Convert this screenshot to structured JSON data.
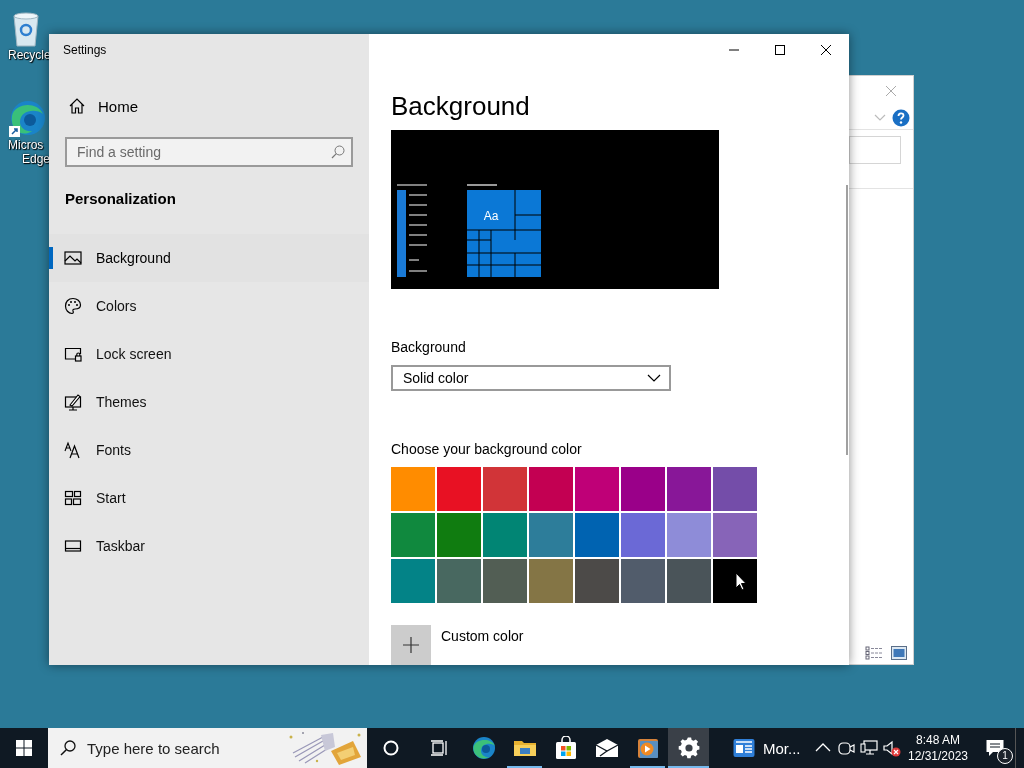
{
  "desktop_icons": [
    {
      "kind": "recycle",
      "lines": [
        "Recycle"
      ]
    },
    {
      "kind": "edge",
      "lines": [
        "Micros",
        "Edge"
      ]
    }
  ],
  "window": {
    "title": "Settings"
  },
  "sidebar": {
    "home": "Home",
    "search": {
      "placeholder": "Find a setting"
    },
    "section": "Personalization",
    "items": [
      {
        "kind": "background",
        "label": "Background",
        "selected": true
      },
      {
        "kind": "colors",
        "label": "Colors",
        "selected": false
      },
      {
        "kind": "lock",
        "label": "Lock screen",
        "selected": false
      },
      {
        "kind": "themes",
        "label": "Themes",
        "selected": false
      },
      {
        "kind": "fonts",
        "label": "Fonts",
        "selected": false
      },
      {
        "kind": "start",
        "label": "Start",
        "selected": false
      },
      {
        "kind": "taskbar",
        "label": "Taskbar",
        "selected": false
      }
    ]
  },
  "content": {
    "title": "Background",
    "preview": {
      "tile_label": "Aa"
    },
    "background_field": {
      "label": "Background",
      "value": "Solid color"
    },
    "color_heading": "Choose your background color",
    "colors": [
      {
        "color": "#ff8c00"
      },
      {
        "color": "#e81123"
      },
      {
        "color": "#d13438"
      },
      {
        "color": "#c30052"
      },
      {
        "color": "#bf0077"
      },
      {
        "color": "#9a0089"
      },
      {
        "color": "#881798"
      },
      {
        "color": "#744da9"
      },
      {
        "color": "#10893e"
      },
      {
        "color": "#107c10"
      },
      {
        "color": "#018574"
      },
      {
        "color": "#2d7d9a"
      },
      {
        "color": "#0063b1"
      },
      {
        "color": "#6b69d6"
      },
      {
        "color": "#8e8cd8"
      },
      {
        "color": "#8764b8"
      },
      {
        "color": "#038387"
      },
      {
        "color": "#486860"
      },
      {
        "color": "#525e54"
      },
      {
        "color": "#847545"
      },
      {
        "color": "#4c4a48"
      },
      {
        "color": "#515c6b"
      },
      {
        "color": "#4a5459"
      },
      {
        "color": "#000000"
      }
    ],
    "custom_color": "Custom color"
  },
  "taskbar": {
    "search": {
      "placeholder": "Type here to search"
    },
    "apps": [
      {
        "kind": "edge",
        "running": false,
        "active": false
      },
      {
        "kind": "explorer",
        "running": true,
        "active": false
      },
      {
        "kind": "store",
        "running": false,
        "active": false
      },
      {
        "kind": "mail",
        "running": false,
        "active": false
      },
      {
        "kind": "media",
        "running": true,
        "active": false
      },
      {
        "kind": "settings",
        "running": true,
        "active": true
      }
    ],
    "news": "Mor...",
    "time": "8:48 AM",
    "date": "12/31/2023",
    "notifications": "1"
  }
}
